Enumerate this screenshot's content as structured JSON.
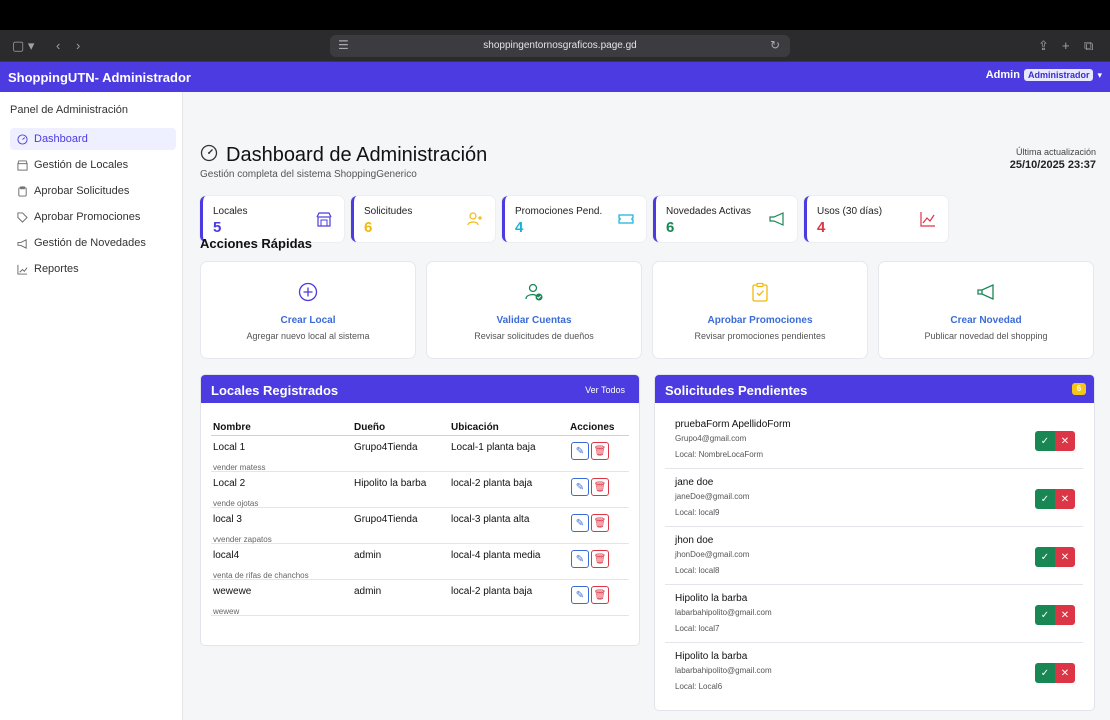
{
  "browser": {
    "url": "shoppingentornosgraficos.page.gd"
  },
  "navbar": {
    "brand": "ShoppingUTN- Administrador",
    "user": "Admin",
    "role": "Administrador"
  },
  "sidebar": {
    "title": "Panel de Administración",
    "items": [
      {
        "label": "Dashboard",
        "icon": "dashboard-icon",
        "active": true
      },
      {
        "label": "Gestión de Locales",
        "icon": "store-icon",
        "active": false
      },
      {
        "label": "Aprobar Solicitudes",
        "icon": "clipboard-icon",
        "active": false
      },
      {
        "label": "Aprobar Promociones",
        "icon": "tag-icon",
        "active": false
      },
      {
        "label": "Gestión de Novedades",
        "icon": "megaphone-icon",
        "active": false
      },
      {
        "label": "Reportes",
        "icon": "chart-icon",
        "active": false
      }
    ]
  },
  "header": {
    "title": "Dashboard de Administración",
    "subtitle": "Gestión completa del sistema ShoppingGenerico",
    "update_label": "Última actualización",
    "update_value": "25/10/2025 23:37"
  },
  "stats": [
    {
      "label": "Locales",
      "value": "5",
      "color": "#4b3be0",
      "icon": "store-icon"
    },
    {
      "label": "Solicitudes",
      "value": "6",
      "color": "#f0b90b",
      "icon": "user-plus-icon"
    },
    {
      "label": "Promociones Pend.",
      "value": "4",
      "color": "#17b2d8",
      "icon": "ticket-icon"
    },
    {
      "label": "Novedades Activas",
      "value": "6",
      "color": "#198754",
      "icon": "megaphone-icon"
    },
    {
      "label": "Usos (30 días)",
      "value": "4",
      "color": "#dc3545",
      "icon": "trend-icon"
    }
  ],
  "quick": {
    "title": "Acciones Rápidas",
    "items": [
      {
        "title": "Crear Local",
        "desc": "Agregar nuevo local al sistema",
        "icon": "plus-circle-icon",
        "color": "#4b3be0"
      },
      {
        "title": "Validar Cuentas",
        "desc": "Revisar solicitudes de dueños",
        "icon": "user-check-icon",
        "color": "#198754"
      },
      {
        "title": "Aprobar Promociones",
        "desc": "Revisar promociones pendientes",
        "icon": "clipboard-check-icon",
        "color": "#f0b90b"
      },
      {
        "title": "Crear Novedad",
        "desc": "Publicar novedad del shopping",
        "icon": "megaphone-icon",
        "color": "#198754"
      }
    ]
  },
  "locales": {
    "title": "Locales Registrados",
    "link": "Ver Todos",
    "columns": [
      "Nombre",
      "Dueño",
      "Ubicación",
      "Acciones"
    ],
    "rows": [
      {
        "name": "Local 1",
        "desc": "vender matess",
        "owner": "Grupo4Tienda",
        "location": "Local-1 planta baja"
      },
      {
        "name": "Local 2",
        "desc": "vende ojotas",
        "owner": "Hipolito la barba",
        "location": "local-2 planta baja"
      },
      {
        "name": "local 3",
        "desc": "vvender zapatos",
        "owner": "Grupo4Tienda",
        "location": "local-3 planta alta"
      },
      {
        "name": "local4",
        "desc": "venta de rifas de chanchos",
        "owner": "admin",
        "location": "local-4 planta media"
      },
      {
        "name": "wewewe",
        "desc": "wewew",
        "owner": "admin",
        "location": "local-2 planta baja"
      }
    ]
  },
  "requests": {
    "title": "Solicitudes Pendientes",
    "count": "6",
    "items": [
      {
        "name": "pruebaForm ApellidoForm",
        "email": "Grupo4@gmail.com",
        "local": "Local: NombreLocaForm"
      },
      {
        "name": "jane doe",
        "email": "janeDoe@gmail.com",
        "local": "Local: local9"
      },
      {
        "name": "jhon doe",
        "email": "jhonDoe@gmail.com",
        "local": "Local: local8"
      },
      {
        "name": "Hipolito la barba",
        "email": "labarbahipolito@gmail.com",
        "local": "Local: local7"
      },
      {
        "name": "Hipolito la barba",
        "email": "labarbahipolito@gmail.com",
        "local": "Local: Local6"
      }
    ]
  }
}
